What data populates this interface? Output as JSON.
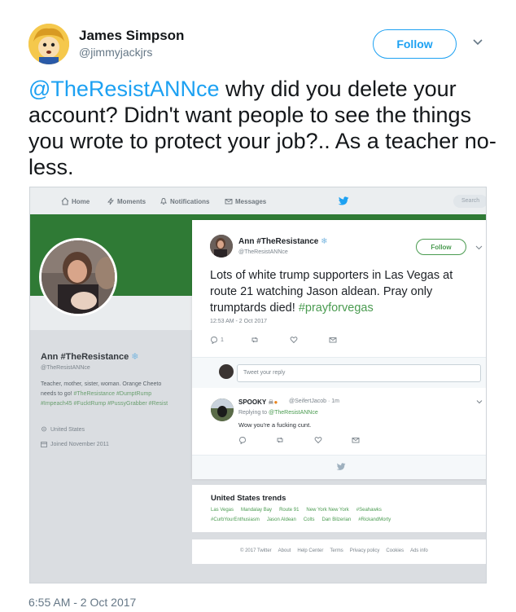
{
  "tweet": {
    "author_name": "James Simpson",
    "author_handle": "@jimmyjackjrs",
    "follow_label": "Follow",
    "mention": "@TheResistANNce",
    "text_rest": " why did you delete your account? Didn't want people to see the things you wrote to protect your job?.. As a teacher no-less.",
    "timestamp": "6:55 AM - 2 Oct 2017"
  },
  "screenshot": {
    "nav": {
      "home": "Home",
      "moments": "Moments",
      "notifications": "Notifications",
      "messages": "Messages",
      "search": "Search"
    },
    "profile": {
      "name": "Ann #TheResistance",
      "handle": "@TheResistANNce",
      "bio_plain": "Teacher, mother, sister, woman. Orange Cheeto needs to go! ",
      "bio_tags": "#TheResistance #DumptRump #Impeach45 #FucktRump #PussyGrabber #Resist",
      "location": "United States",
      "joined": "Joined November 2011"
    },
    "modal_tweet": {
      "name": "Ann #TheResistance",
      "handle": "@TheResistANNce",
      "follow_label": "Follow",
      "text": "Lots of white trump supporters in Las Vegas at route 21 watching Jason aldean. Pray only trumptards died! ",
      "hashtag": "#prayforvegas",
      "time": "12:53 AM - 2 Oct 2017",
      "reply_count": "1",
      "reply_placeholder": "Tweet your reply"
    },
    "reply": {
      "name": "SPOOKY",
      "handle": "@SeifertJacob · 1m",
      "replying_prefix": "Replying to ",
      "replying_to": "@TheResistANNce",
      "text": "Wow you're a fucking cunt."
    },
    "trends": {
      "title": "United States trends",
      "row1": [
        "Las Vegas",
        "Mandalay Bay",
        "Route 91",
        "New York New York",
        "#Seahawks"
      ],
      "row2": [
        "#CurbYourEnthusiasm",
        "Jason Aldean",
        "Colts",
        "Dan Bilzerian",
        "#RickandMorty"
      ]
    },
    "footer": [
      "© 2017 Twitter",
      "About",
      "Help Center",
      "Terms",
      "Privacy policy",
      "Cookies",
      "Ads info"
    ]
  },
  "colors": {
    "twitter_blue": "#1da1f2",
    "profile_green": "#4a9b50",
    "banner_green": "#2f7a35"
  }
}
